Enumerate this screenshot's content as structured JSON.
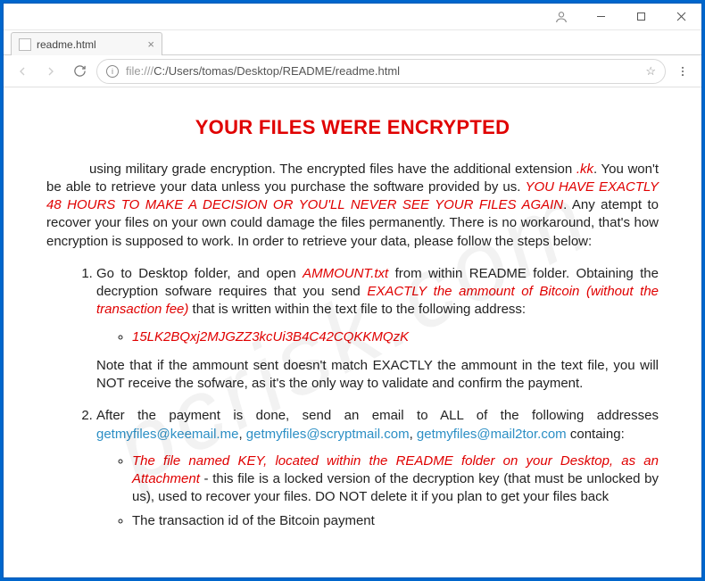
{
  "window": {
    "tab_title": "readme.html",
    "url_scheme": "file:///",
    "url_path": "C:/Users/tomas/Desktop/README/readme.html"
  },
  "page": {
    "heading": "YOUR FILES WERE ENCRYPTED",
    "intro_1": "using military grade encryption. The encrypted files have the additional extension ",
    "ext": ".kk",
    "intro_2": ". You won't be able to retrieve your data unless you purchase the software provided by us. ",
    "deadline": "YOU HAVE EXACTLY 48 HOURS TO MAKE A DECISION OR YOU'LL NEVER SEE YOUR FILES AGAIN",
    "intro_3": ". Any atempt to recover your files on your own could damage the files permanently. There is no workaround, that's how encryption is supposed to work. In order to retrieve your data, please follow the steps below:",
    "step1_a": "Go to Desktop folder, and open ",
    "step1_file": "AMMOUNT.txt",
    "step1_b": " from within README folder. Obtaining the decryption sofware requires that you send ",
    "step1_amount": "EXACTLY the ammount of Bitcoin (without the transaction fee)",
    "step1_c": " that is written within the text file to the following address:",
    "btc_addr": "15LK2BQxj2MJGZZ3kcUi3B4C42CQKKMQzK",
    "step1_note": "Note that if the ammount sent doesn't match EXACTLY the ammount in the text file, you will NOT receive the sofware, as it's the only way to validate and confirm the payment.",
    "step2_a": "After the payment is done, send an email to ALL of the following addresses ",
    "email1": "getmyfiles@keemail.me",
    "sep": ", ",
    "email2": "getmyfiles@scryptmail.com",
    "email3": "getmyfiles@mail2tor.com",
    "step2_b": " containg:",
    "step2_sub1_a": "The file named KEY, located within the README folder on your Desktop, as an Attachment",
    "step2_sub1_b": " - this file is a locked version of the decryption key (that must be unlocked by us), used to recover your files. DO NOT delete it if you plan to get your files back",
    "step2_sub2": "The transaction id of the Bitcoin payment"
  },
  "watermark": "pcrisk.com"
}
